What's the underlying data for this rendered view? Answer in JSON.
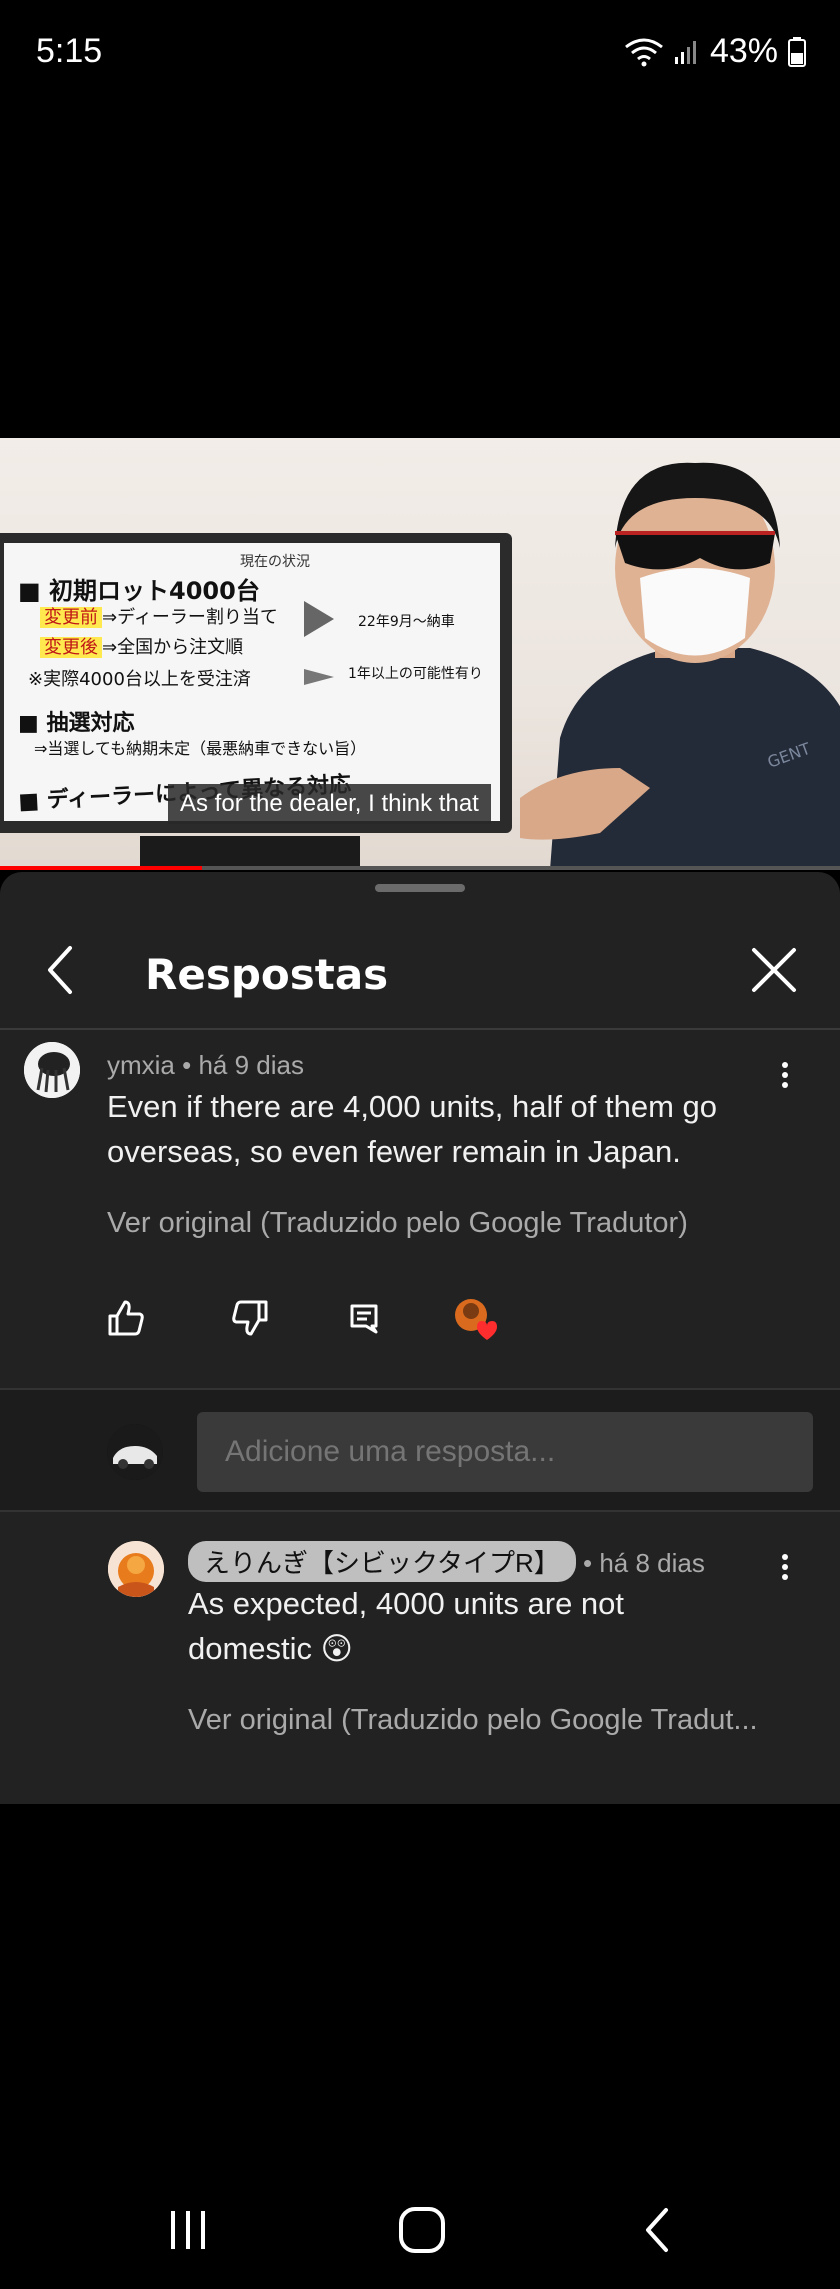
{
  "status_bar": {
    "time": "5:15",
    "battery": "43%"
  },
  "video": {
    "slide": {
      "header": "現在の状況",
      "line1": "■ 初期ロット4000台",
      "tag_before": "変更前",
      "line2_text": "⇒ディーラー割り当て",
      "tag_after": "変更後",
      "line3_text": "⇒全国から注文順",
      "line4": "※実際4000台以上を受注済",
      "note1": "22年9月～納車",
      "note2": "1年以上の可能性有り",
      "line5": "■ 抽選対応",
      "line6": "⇒当選しても納期未定（最悪納車できない旨）",
      "line7": "■ ディーラーによって異なる対応"
    },
    "subtitle": "As for the dealer, I think that",
    "progress_fraction": 0.24
  },
  "panel": {
    "title": "Respostas"
  },
  "comment": {
    "author": "ymxia",
    "time": "há 9 dias",
    "text": "Even if there are 4,000 units, half of them go overseas, so even fewer remain in Japan.",
    "see_original": "Ver original (Traduzido pelo Google Tradutor)"
  },
  "reply_box": {
    "placeholder": "Adicione uma resposta..."
  },
  "reply": {
    "author": "えりんぎ【シビックタイプR】",
    "time": "há 8 dias",
    "text": "As expected, 4000 units are not domestic 😲",
    "see_original": "Ver original (Traduzido pelo Google Tradut..."
  },
  "colors": {
    "panel_bg": "#222222",
    "progress_red": "#ff0000",
    "meta_gray": "#aaaaaa"
  }
}
